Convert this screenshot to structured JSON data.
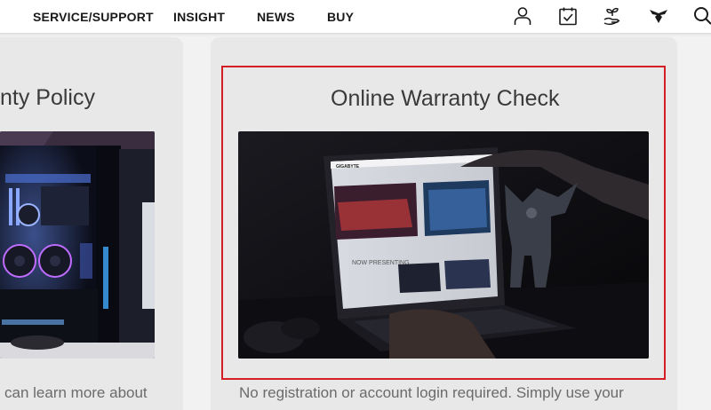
{
  "nav": {
    "links": [
      "SERVICE/SUPPORT",
      "INSIGHT",
      "NEWS",
      "BUY"
    ],
    "icons": [
      "user-icon",
      "calendar-check-icon",
      "plant-hand-icon",
      "aorus-eagle-icon",
      "search-icon"
    ]
  },
  "cards": {
    "left": {
      "title": "nty Policy",
      "desc": "can learn more about",
      "image": "gaming-pc-case-image"
    },
    "right": {
      "title": "Online Warranty Check",
      "desc": "No registration or account login required. Simply use your",
      "image": "gaming-laptop-image",
      "laptop_brand": "GIGABYTE",
      "laptop_screen_text": "NOW PRESENTING"
    }
  },
  "colors": {
    "highlight": "#d41e26",
    "card_bg": "#e8e8e8",
    "page_bg": "#f2f2f2"
  }
}
